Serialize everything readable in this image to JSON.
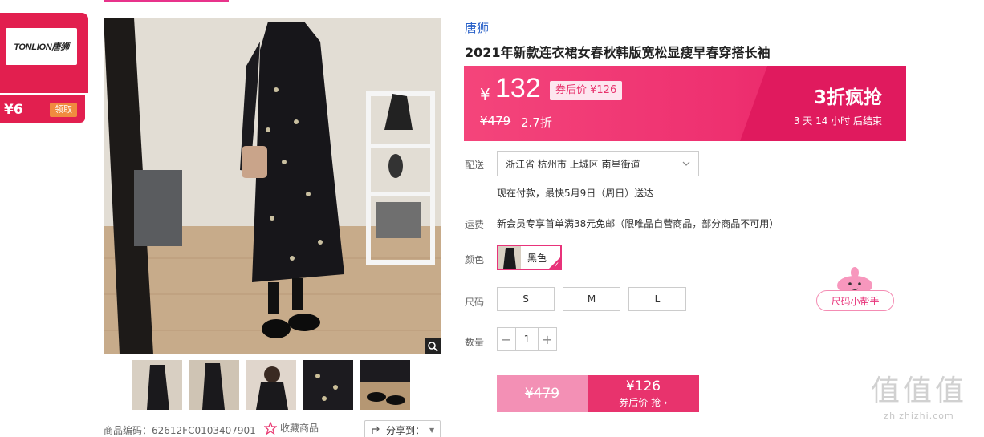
{
  "coupon": {
    "logo_text": "TONLION唐狮",
    "amount": "¥6",
    "claim_label": "领取"
  },
  "product": {
    "brand": "唐狮",
    "title": "2021年新款连衣裙女春秋韩版宽松显瘦早春穿搭长袖",
    "code_label": "商品编码：62612FC0103407901",
    "favorite_label": "收藏商品",
    "share_label": "分享到："
  },
  "price": {
    "currency": "¥",
    "current": "132",
    "coupon_price": "券后价 ¥126",
    "original": "¥479",
    "discount": "2.7折",
    "promo_title": "3折疯抢",
    "countdown": "3 天 14 小时 后结束"
  },
  "delivery": {
    "label": "配送",
    "address": "浙江省 杭州市 上城区 南星街道",
    "time_note": "现在付款，最快5月9日（周日）送达"
  },
  "shipping_fee": {
    "label": "运费",
    "text": "新会员专享首单满38元免邮（限唯品自营商品，部分商品不可用）"
  },
  "color": {
    "label": "颜色",
    "selected": "黑色"
  },
  "size": {
    "label": "尺码",
    "options": [
      "S",
      "M",
      "L"
    ],
    "helper": "尺码小帮手"
  },
  "quantity": {
    "label": "数量",
    "value": "1",
    "minus": "−",
    "plus": "+"
  },
  "buy": {
    "original": "¥479",
    "price": "¥126",
    "action": "券后价 抢"
  },
  "watermark": {
    "logo": "值值值",
    "url": "zhizhizhi.com"
  },
  "colors": {
    "accent": "#e8336d",
    "coupon_red": "#e21f4f",
    "brand_link": "#2a62c9"
  }
}
